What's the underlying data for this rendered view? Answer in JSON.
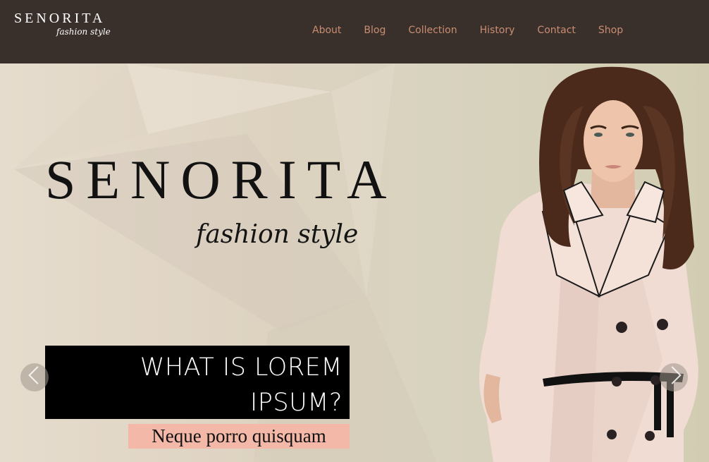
{
  "header": {
    "logo_title": "SENORITA",
    "logo_subtitle": "fashion style",
    "nav": [
      "About",
      "Blog",
      "Collection",
      "History",
      "Contact",
      "Shop"
    ]
  },
  "hero": {
    "title": "SENORITA",
    "subtitle": "fashion style",
    "caption_line1": "WHAT IS LOREM",
    "caption_line2": "IPSUM?",
    "caption_sub": "Neque porro quisquam",
    "prev_icon": "chevron-left-icon",
    "next_icon": "chevron-right-icon"
  },
  "colors": {
    "header_bg": "#3a302b",
    "nav_link": "#c98d72",
    "caption_bg": "#000000",
    "caption_sub_bg": "#f3b8a7"
  }
}
